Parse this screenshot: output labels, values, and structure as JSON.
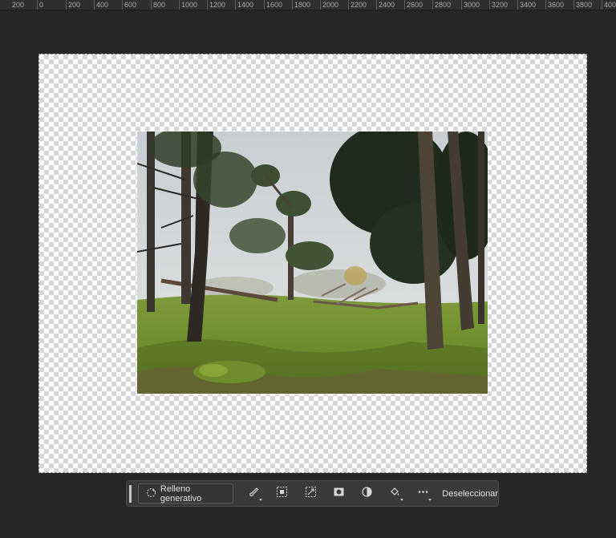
{
  "ruler": {
    "labels": [
      "200",
      "0",
      "200",
      "400",
      "600",
      "800",
      "1000",
      "1200",
      "1400",
      "1600",
      "1800",
      "2000",
      "2200",
      "2400",
      "2600",
      "2800",
      "3000",
      "3200",
      "3400",
      "3600",
      "3800",
      "400"
    ]
  },
  "canvas": {
    "background": "transparent-checkerboard"
  },
  "photo": {
    "subject": "forest-clearing-with-pine-trees"
  },
  "toolbar": {
    "generative_fill_label": "Relleno generativo",
    "deselect_label": "Deseleccionar",
    "tools": [
      "brush-icon",
      "select-subject-icon",
      "transform-selection-icon",
      "mask-icon",
      "adjustment-icon",
      "fill-bucket-icon",
      "more-icon"
    ]
  },
  "colors": {
    "workspace": "#262626",
    "toolbar": "#3a3a3a",
    "text": "#e4e4e4"
  }
}
